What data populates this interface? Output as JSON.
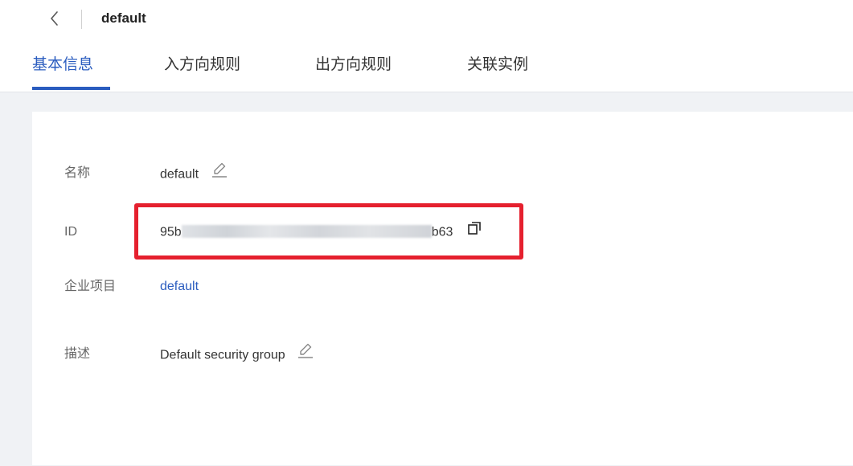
{
  "header": {
    "title": "default"
  },
  "tabs": [
    {
      "label": "基本信息",
      "active": true
    },
    {
      "label": "入方向规则",
      "active": false
    },
    {
      "label": "出方向规则",
      "active": false
    },
    {
      "label": "关联实例",
      "active": false
    }
  ],
  "details": {
    "name": {
      "label": "名称",
      "value": "default"
    },
    "id": {
      "label": "ID",
      "prefix": "95b",
      "suffix": "b63"
    },
    "enterprise_project": {
      "label": "企业项目",
      "value": "default"
    },
    "description": {
      "label": "描述",
      "value": "Default security group"
    }
  },
  "icons": {
    "back": "chevron-left-icon",
    "edit": "pencil-icon",
    "copy": "copy-icon"
  },
  "colors": {
    "accent": "#2a5cbf",
    "highlight": "#e5202e",
    "background": "#f0f2f5"
  }
}
